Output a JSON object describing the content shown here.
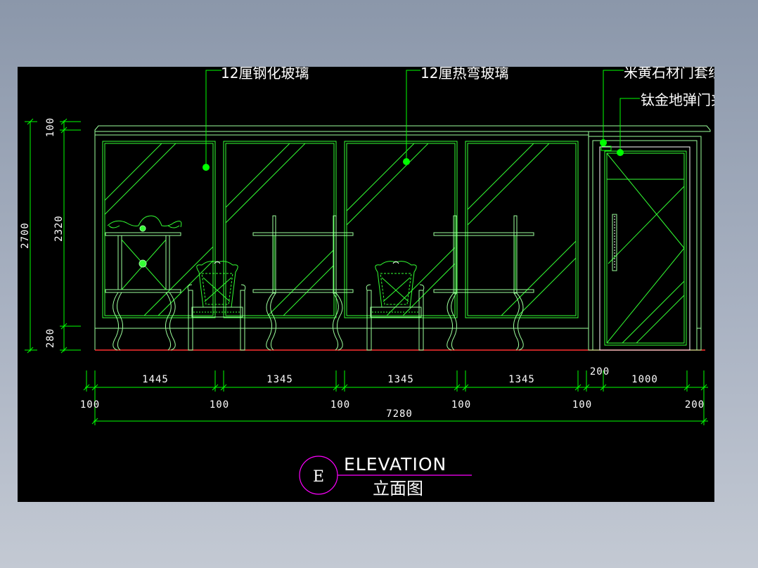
{
  "labels": {
    "glass_tempered": "12厘钢化玻璃",
    "glass_bent": "12厘热弯玻璃",
    "door_frame": "米黄石材门套线",
    "door_clip": "钛金地弹门夹"
  },
  "vertical_dims": {
    "total": "2700",
    "top": "100",
    "middle": "2320",
    "bottom": "280"
  },
  "horizontal_dims": {
    "upper": [
      "1445",
      "1345",
      "1345",
      "1345",
      "200",
      "1000"
    ],
    "lower": [
      "100",
      "100",
      "100",
      "100",
      "100",
      "200"
    ],
    "total": "7280"
  },
  "title": {
    "letter": "E",
    "english": "ELEVATION",
    "chinese": "立面图"
  },
  "colors": {
    "canvas": "#000000",
    "line_main": "#00ff00",
    "line_light": "#88ff88",
    "cyan": "#00ffff",
    "floor": "#ff3030",
    "title_circle": "#ff00ff",
    "text": "#ffffff"
  }
}
